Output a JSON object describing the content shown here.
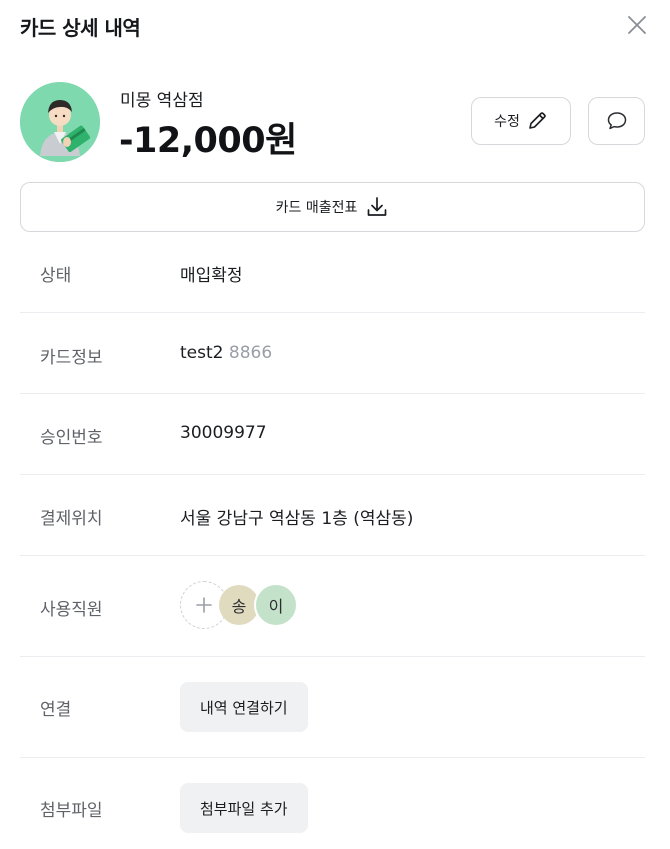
{
  "header": {
    "title": "카드 상세 내역",
    "close_icon": "close-icon"
  },
  "merchant": {
    "name": "미몽 역삼점",
    "amount": "-12,000원",
    "avatar_icon": "person-with-card-icon",
    "avatar_color": "#7fd9ae",
    "edit_label": "수정",
    "edit_icon": "pencil-icon",
    "comment_icon": "comment-icon"
  },
  "receipt": {
    "label": "카드 매출전표",
    "icon": "download-icon"
  },
  "details": {
    "status": {
      "label": "상태",
      "value": "매입확정"
    },
    "card": {
      "label": "카드정보",
      "name": "test2",
      "number": "8866"
    },
    "approval": {
      "label": "승인번호",
      "value": "30009977"
    },
    "location": {
      "label": "결제위치",
      "value": "서울 강남구 역삼동 1층 (역삼동)"
    },
    "employees": {
      "label": "사용직원",
      "add_icon": "plus-icon",
      "members": [
        "송",
        "이"
      ]
    },
    "link": {
      "label": "연결",
      "button": "내역 연결하기"
    },
    "attachment": {
      "label": "첨부파일",
      "button": "첨부파일 추가"
    }
  }
}
